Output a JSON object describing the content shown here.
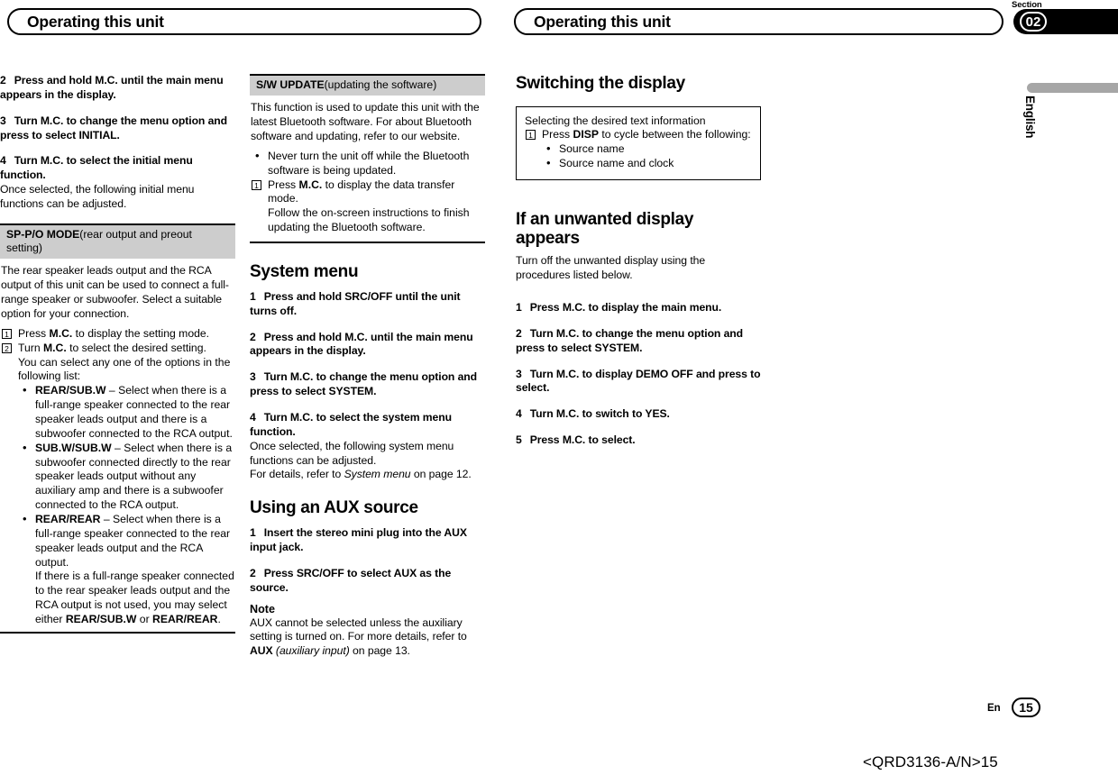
{
  "header": {
    "running_title_left": "Operating this unit",
    "running_title_right": "Operating this unit",
    "section_label": "Section",
    "section_number": "02",
    "language_tab": "English"
  },
  "footer": {
    "lang_code": "En",
    "page_number": "15",
    "doc_id": "<QRD3136-A/N>15"
  },
  "column1": {
    "steps": [
      {
        "n": "2",
        "text": "Press and hold M.C. until the main menu appears in the display."
      },
      {
        "n": "3",
        "text": "Turn M.C. to change the menu option and press to select INITIAL."
      },
      {
        "n": "4",
        "text": "Turn M.C. to select the initial menu function."
      }
    ],
    "after_step4": "Once selected, the following initial menu functions can be adjusted.",
    "spmode": {
      "band_title": "SP-P/O MODE",
      "band_subtitle": "(rear output and preout setting)",
      "intro": "The rear speaker leads output and the RCA output of this unit can be used to connect a full-range speaker or subwoofer. Select a suitable option for your connection.",
      "items": [
        {
          "num": "1",
          "pre": "Press ",
          "bold": "M.C.",
          "post": " to display the setting mode."
        },
        {
          "num": "2",
          "pre": "Turn ",
          "bold": "M.C.",
          "post": " to select the desired setting."
        }
      ],
      "item2_cont": "You can select any one of the options in the following list:",
      "options": [
        {
          "term": "REAR/SUB.W",
          "desc": " – Select when there is a full-range speaker connected to the rear speaker leads output and there is a subwoofer connected to the RCA output."
        },
        {
          "term": "SUB.W/SUB.W",
          "desc": " – Select when there is a subwoofer connected directly to the rear speaker leads output without any auxiliary amp and there is a subwoofer connected to the RCA output."
        },
        {
          "term": "REAR/REAR",
          "desc": " – Select when there is a full-range speaker connected to the rear speaker leads output and the RCA output."
        }
      ],
      "closing_pre": "If there is a full-range speaker connected to the rear speaker leads output and the RCA output is not used, you may select either ",
      "closing_b1": "REAR/SUB.W",
      "closing_mid": " or ",
      "closing_b2": "REAR/REAR",
      "closing_end": "."
    }
  },
  "column2": {
    "swupdate": {
      "band_title": "S/W UPDATE",
      "band_subtitle": "(updating the software)",
      "intro": "This function is used to update this unit with the latest Bluetooth software. For about Bluetooth software and updating, refer to our website.",
      "bullet": "Never turn the unit off while the Bluetooth software is being updated.",
      "item_num": "1",
      "item_pre": "Press ",
      "item_bold": "M.C.",
      "item_post": " to display the data transfer mode.",
      "item_cont": "Follow the on-screen instructions to finish updating the Bluetooth software."
    },
    "system_menu": {
      "heading": "System menu",
      "steps": [
        {
          "n": "1",
          "text": "Press and hold SRC/OFF until the unit turns off."
        },
        {
          "n": "2",
          "text": "Press and hold M.C. until the main menu appears in the display."
        },
        {
          "n": "3",
          "text": "Turn M.C. to change the menu option and press to select SYSTEM."
        },
        {
          "n": "4",
          "text": "Turn M.C. to select the system menu function."
        }
      ],
      "after_step4": "Once selected, the following system menu functions can be adjusted.",
      "refer_pre": "For details, refer to ",
      "refer_italic": "System menu",
      "refer_post": " on page 12."
    },
    "aux": {
      "heading": "Using an AUX source",
      "steps": [
        {
          "n": "1",
          "text": "Insert the stereo mini plug into the AUX input jack."
        },
        {
          "n": "2",
          "text": "Press SRC/OFF to select AUX as the source."
        }
      ],
      "note_heading": "Note",
      "note_pre": "AUX cannot be selected unless the auxiliary setting is turned on. For more details, refer to ",
      "note_bold": "AUX",
      "note_italic": " (auxiliary input)",
      "note_post": " on page 13."
    }
  },
  "column3": {
    "switching": {
      "heading": "Switching the display",
      "box_intro": "Selecting the desired text information",
      "box_item_num": "1",
      "box_item_pre": "Press ",
      "box_item_bold": "DISP",
      "box_item_post": " to cycle between the following:",
      "box_bullets": [
        "Source name",
        "Source name and clock"
      ]
    },
    "unwanted": {
      "heading": "If an unwanted display appears",
      "intro": "Turn off the unwanted display using the procedures listed below.",
      "steps": [
        {
          "n": "1",
          "text": "Press M.C. to display the main menu."
        },
        {
          "n": "2",
          "text": "Turn M.C. to change the menu option and press to select SYSTEM."
        },
        {
          "n": "3",
          "text": "Turn M.C. to display DEMO OFF and press to select."
        },
        {
          "n": "4",
          "text": "Turn M.C. to switch to YES."
        },
        {
          "n": "5",
          "text": "Press M.C. to select."
        }
      ]
    }
  }
}
